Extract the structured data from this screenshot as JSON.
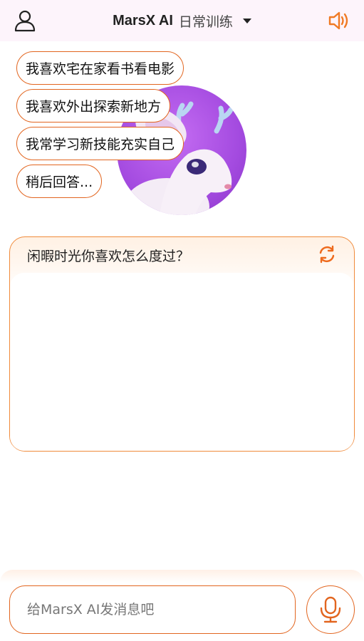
{
  "header": {
    "brand": "MarsX AI",
    "mode": "日常训练",
    "icons": {
      "user": "user-icon",
      "mode_dropdown": "caret-down-icon",
      "sound": "speaker-icon"
    }
  },
  "assistant": {
    "avatar": "deer-avatar"
  },
  "question_card": {
    "question": "闲暇时光你喜欢怎么度过？",
    "refresh_icon": "refresh-icon",
    "options": [
      "我喜欢宅在家看书看电影",
      "我喜欢外出探索新地方",
      "我常学习新技能充实自己",
      "稍后回答..."
    ]
  },
  "composer": {
    "placeholder": "给MarsX AI发消息吧",
    "mic_icon": "microphone-icon"
  },
  "colors": {
    "accent": "#e2651f",
    "header_bg": "#fdf4fb",
    "avatar_bg": "#a44be0"
  }
}
